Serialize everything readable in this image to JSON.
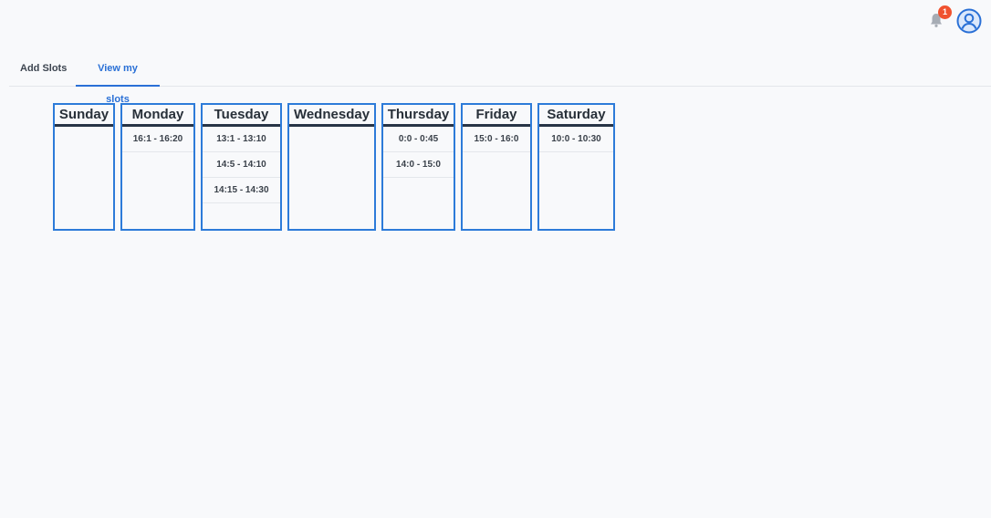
{
  "header": {
    "notification_count": "1",
    "icons": {
      "bell": "bell-icon",
      "avatar": "user-avatar-icon"
    },
    "colors": {
      "badge": "#f0522f",
      "accent": "#2a70d6"
    }
  },
  "tabs": [
    {
      "label": "Add Slots",
      "active": false
    },
    {
      "label": "View my slots",
      "active": true
    }
  ],
  "days": [
    {
      "name": "Sunday",
      "slots": []
    },
    {
      "name": "Monday",
      "slots": [
        "16:1 - 16:20"
      ]
    },
    {
      "name": "Tuesday",
      "slots": [
        "13:1 - 13:10",
        "14:5 - 14:10",
        "14:15 - 14:30"
      ]
    },
    {
      "name": "Wednesday",
      "slots": []
    },
    {
      "name": "Thursday",
      "slots": [
        "0:0 - 0:45",
        "14:0 - 15:0"
      ]
    },
    {
      "name": "Friday",
      "slots": [
        "15:0 - 16:0"
      ]
    },
    {
      "name": "Saturday",
      "slots": [
        "10:0 - 10:30"
      ]
    }
  ]
}
